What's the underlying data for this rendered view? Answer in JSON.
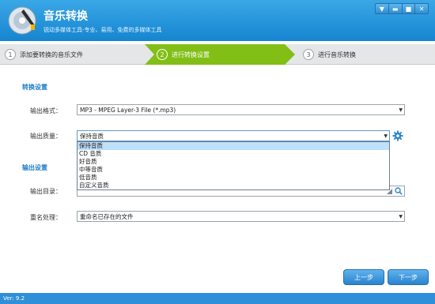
{
  "app": {
    "title": "音乐转换",
    "subtitle": "锐动多媒体工具-专业、易用、免费的多媒体工具"
  },
  "window_controls": [
    "▼",
    "▬",
    "■",
    "✕"
  ],
  "steps": [
    {
      "num": "1",
      "label": "添加要转换的音乐文件"
    },
    {
      "num": "2",
      "label": "进行转换设置"
    },
    {
      "num": "3",
      "label": "进行音乐转换"
    }
  ],
  "conversion_settings": {
    "section_title": "转换设置",
    "format_label": "输出格式：",
    "format_value": "MP3 - MPEG Layer-3 File (*.mp3)",
    "quality_label": "输出质量：",
    "quality_value": "保持音质",
    "quality_options": [
      "保持音质",
      "CD 音质",
      "好音质",
      "中等音质",
      "低音质",
      "自定义音质"
    ]
  },
  "output_settings": {
    "section_title": "输出设置",
    "dir_label": "输出目录：",
    "dir_value": "",
    "rename_label": "重名处理：",
    "rename_value": "重命名已存在的文件"
  },
  "buttons": {
    "prev": "上一步",
    "next": "下一步"
  },
  "status": {
    "version": "Ver: 9.2"
  },
  "colors": {
    "title_bar": "#1e8fd8",
    "active_step": "#82bf16",
    "section_title": "#1a7cc7"
  }
}
